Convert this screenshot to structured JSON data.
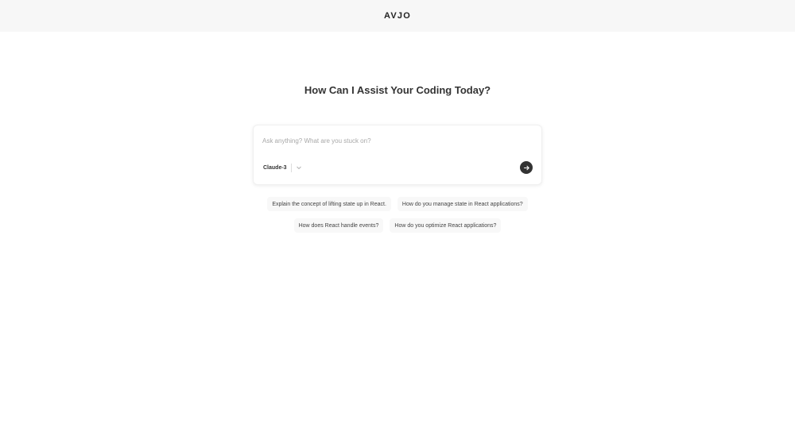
{
  "header": {
    "brand": "AVJO"
  },
  "main": {
    "headline": "How Can I Assist Your Coding Today?",
    "composer": {
      "placeholder": "Ask anything? What are you stuck on?",
      "value": "",
      "model": "Claude-3",
      "model_icon": "chevron-down-icon",
      "send_icon": "arrow-right-icon"
    },
    "suggestions": [
      [
        "Explain the concept of lifting state up in React.",
        "How do you manage state in React applications?"
      ],
      [
        "How does React handle events?",
        "How do you optimize React applications?"
      ]
    ]
  },
  "colors": {
    "topbar_bg": "#f7f7f7",
    "chip_bg": "#f8f8f8",
    "send_bg": "#333333"
  }
}
